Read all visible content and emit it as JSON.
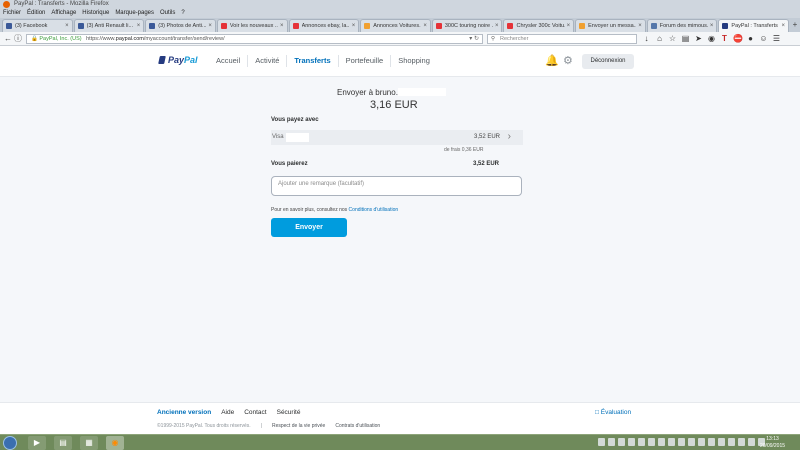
{
  "browser": {
    "window_title": "PayPal : Transferts - Mozilla Firefox",
    "menu": [
      "Fichier",
      "Édition",
      "Affichage",
      "Historique",
      "Marque-pages",
      "Outils",
      "?"
    ],
    "tabs": [
      {
        "label": "(3) Facebook",
        "color": "#3b5998",
        "active": false
      },
      {
        "label": "(3) Anti Renault li...",
        "color": "#3b5998",
        "active": false
      },
      {
        "label": "(3) Photos de Anti...",
        "color": "#3b5998",
        "active": false
      },
      {
        "label": "Voir les nouveaux ...",
        "color": "#e53238",
        "active": false
      },
      {
        "label": "Annonces ebay, la...",
        "color": "#e53238",
        "active": false
      },
      {
        "label": "Annonces Voitures...",
        "color": "#f0a030",
        "active": false
      },
      {
        "label": "300C touring noire ...",
        "color": "#e53238",
        "active": false
      },
      {
        "label": "Chrysler 300c Voitu...",
        "color": "#e53238",
        "active": false
      },
      {
        "label": "Envoyer un messa...",
        "color": "#f0a030",
        "active": false
      },
      {
        "label": "Forum des mimous...",
        "color": "#5577aa",
        "active": false
      },
      {
        "label": "PayPal : Transferts",
        "color": "#253b80",
        "active": true
      }
    ],
    "url_ev": "PayPal, Inc. (US)",
    "url_prefix": "https://www.",
    "url_host": "paypal.com",
    "url_rest": "/myaccount/transfer/send/review/",
    "search_placeholder": "Rechercher"
  },
  "header": {
    "logo_pay": "Pay",
    "logo_pal": "Pal",
    "nav": [
      "Accueil",
      "Activité",
      "Transferts",
      "Portefeuille",
      "Shopping"
    ],
    "active_nav": "Transferts",
    "logout_label": "Déconnexion"
  },
  "main": {
    "send_to": "Envoyer à bruno.",
    "amount": "3,16 EUR",
    "you_pay_label": "Vous payez avec",
    "payment_method": "Visa",
    "payment_value": "3,52 EUR",
    "fees": "de frais 0,36 EUR",
    "total_label": "Vous paierez",
    "total_value": "3,52 EUR",
    "remark_placeholder": "Ajouter une remarque (facultatif)",
    "terms_text": "Pour en savoir plus, consultez nos",
    "terms_link": "Conditions d'utilisation",
    "send_button": "Envoyer"
  },
  "footer": {
    "links": [
      "Ancienne version",
      "Aide",
      "Contact",
      "Sécurité"
    ],
    "feedback": "Évaluation",
    "copyright": "©1999-2015 PayPal. Tous droits réservés.",
    "privacy": "Respect de la vie privée",
    "terms": "Contrats d'utilisation"
  },
  "taskbar": {
    "time": "13:13",
    "date": "20/09/2015"
  }
}
